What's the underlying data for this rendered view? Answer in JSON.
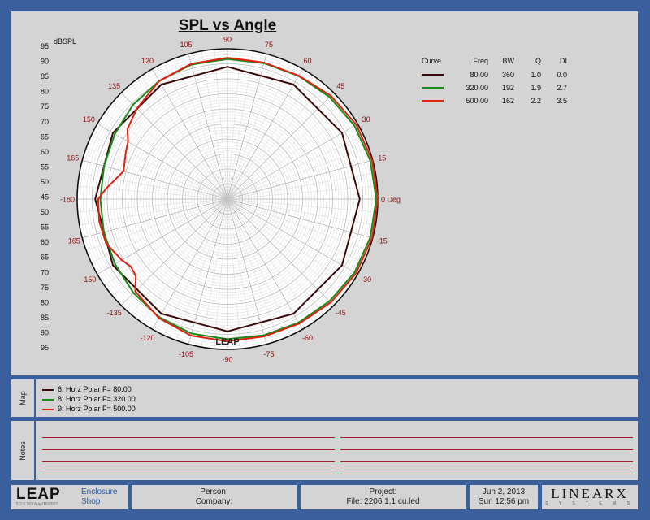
{
  "chart_data": {
    "type": "polar",
    "title": "SPL vs Angle",
    "radial_unit": "dBSPL",
    "radial_ticks": [
      95,
      90,
      85,
      80,
      75,
      70,
      65,
      60,
      55,
      50,
      45,
      50,
      55,
      60,
      65,
      70,
      75,
      80,
      85,
      90,
      95
    ],
    "angle_labels": [
      {
        "deg": 0,
        "text": "0 Deg"
      },
      {
        "deg": 15,
        "text": "15"
      },
      {
        "deg": 30,
        "text": "30"
      },
      {
        "deg": 45,
        "text": "45"
      },
      {
        "deg": 60,
        "text": "60"
      },
      {
        "deg": 75,
        "text": "75"
      },
      {
        "deg": 90,
        "text": "90"
      },
      {
        "deg": 105,
        "text": "105"
      },
      {
        "deg": 120,
        "text": "120"
      },
      {
        "deg": 135,
        "text": "135"
      },
      {
        "deg": 150,
        "text": "150"
      },
      {
        "deg": 165,
        "text": "165"
      },
      {
        "deg": 180,
        "text": "-180"
      },
      {
        "deg": -165,
        "text": "-165"
      },
      {
        "deg": -150,
        "text": "-150"
      },
      {
        "deg": -135,
        "text": "-135"
      },
      {
        "deg": -120,
        "text": "-120"
      },
      {
        "deg": -105,
        "text": "-105"
      },
      {
        "deg": -90,
        "text": "-90"
      },
      {
        "deg": -75,
        "text": "-75"
      },
      {
        "deg": -60,
        "text": "-60"
      },
      {
        "deg": -45,
        "text": "-45"
      },
      {
        "deg": -30,
        "text": "-30"
      },
      {
        "deg": -15,
        "text": "-15"
      }
    ],
    "rlim": [
      45,
      95
    ],
    "legend_headers": [
      "Curve",
      "Freq",
      "BW",
      "Q",
      "DI"
    ],
    "series": [
      {
        "freq": "80.00",
        "bw": "360",
        "q": "1.0",
        "di": "0.0",
        "color": "#3a0a0a",
        "points": [
          [
            0,
            89
          ],
          [
            30,
            89
          ],
          [
            60,
            89
          ],
          [
            90,
            89
          ],
          [
            120,
            89
          ],
          [
            150,
            89
          ],
          [
            180,
            89
          ],
          [
            -150,
            89
          ],
          [
            -120,
            89
          ],
          [
            -90,
            89
          ],
          [
            -60,
            89
          ],
          [
            -30,
            89
          ]
        ]
      },
      {
        "freq": "320.00",
        "bw": "192",
        "q": "1.9",
        "di": "2.7",
        "color": "#1a8a1a",
        "points": [
          [
            0,
            94.5
          ],
          [
            15,
            94.2
          ],
          [
            30,
            93.8
          ],
          [
            45,
            93
          ],
          [
            60,
            92.3
          ],
          [
            75,
            91.8
          ],
          [
            90,
            91.6
          ],
          [
            105,
            91.3
          ],
          [
            120,
            90.4
          ],
          [
            135,
            89.4
          ],
          [
            150,
            88.3
          ],
          [
            165,
            87.5
          ],
          [
            180,
            87.3
          ],
          [
            -165,
            87.6
          ],
          [
            -150,
            88.2
          ],
          [
            -135,
            89.2
          ],
          [
            -120,
            90.4
          ],
          [
            -105,
            91.3
          ],
          [
            -90,
            91.6
          ],
          [
            -75,
            91.9
          ],
          [
            -60,
            92.4
          ],
          [
            -45,
            93
          ],
          [
            -30,
            93.8
          ],
          [
            -15,
            94.2
          ]
        ]
      },
      {
        "freq": "500.00",
        "bw": "162",
        "q": "2.2",
        "di": "3.5",
        "color": "#e02010",
        "points": [
          [
            0,
            95
          ],
          [
            15,
            94.8
          ],
          [
            30,
            94.5
          ],
          [
            45,
            93.6
          ],
          [
            60,
            92.4
          ],
          [
            75,
            92
          ],
          [
            90,
            92
          ],
          [
            105,
            91.6
          ],
          [
            120,
            90.4
          ],
          [
            135,
            87.6
          ],
          [
            145,
            85.6
          ],
          [
            150,
            83.2
          ],
          [
            155,
            82.3
          ],
          [
            165,
            80.8
          ],
          [
            175,
            85.5
          ],
          [
            180,
            88
          ],
          [
            -170,
            88.3
          ],
          [
            -160,
            88
          ],
          [
            -150,
            85.6
          ],
          [
            -145,
            84.2
          ],
          [
            -140,
            84.8
          ],
          [
            -135,
            88.4
          ],
          [
            -120,
            90.7
          ],
          [
            -105,
            92
          ],
          [
            -90,
            92.3
          ],
          [
            -75,
            92.3
          ],
          [
            -60,
            92.8
          ],
          [
            -45,
            93.6
          ],
          [
            -30,
            94.4
          ],
          [
            -15,
            94.8
          ]
        ]
      }
    ]
  },
  "map": {
    "label": "Map",
    "items": [
      {
        "text": "6: Horz Polar F=  80.00",
        "color": "#3a0a0a"
      },
      {
        "text": "8: Horz Polar F= 320.00",
        "color": "#1a8a1a"
      },
      {
        "text": "9: Horz Polar F= 500.00",
        "color": "#e02010"
      }
    ]
  },
  "notes": {
    "label": "Notes"
  },
  "footer": {
    "logo": "LEAP",
    "version": "5.2.6.363  May/16/2007",
    "app_line1": "Enclosure",
    "app_line2": "Shop",
    "person": "Person:",
    "company": "Company:",
    "project": "Project:",
    "file": "File: 2206 1.1 cu.led",
    "date": "Jun  2, 2013",
    "time": "Sun 12:56 pm",
    "brand": "LINEARX",
    "brand_sub": "S Y S T E M S"
  }
}
